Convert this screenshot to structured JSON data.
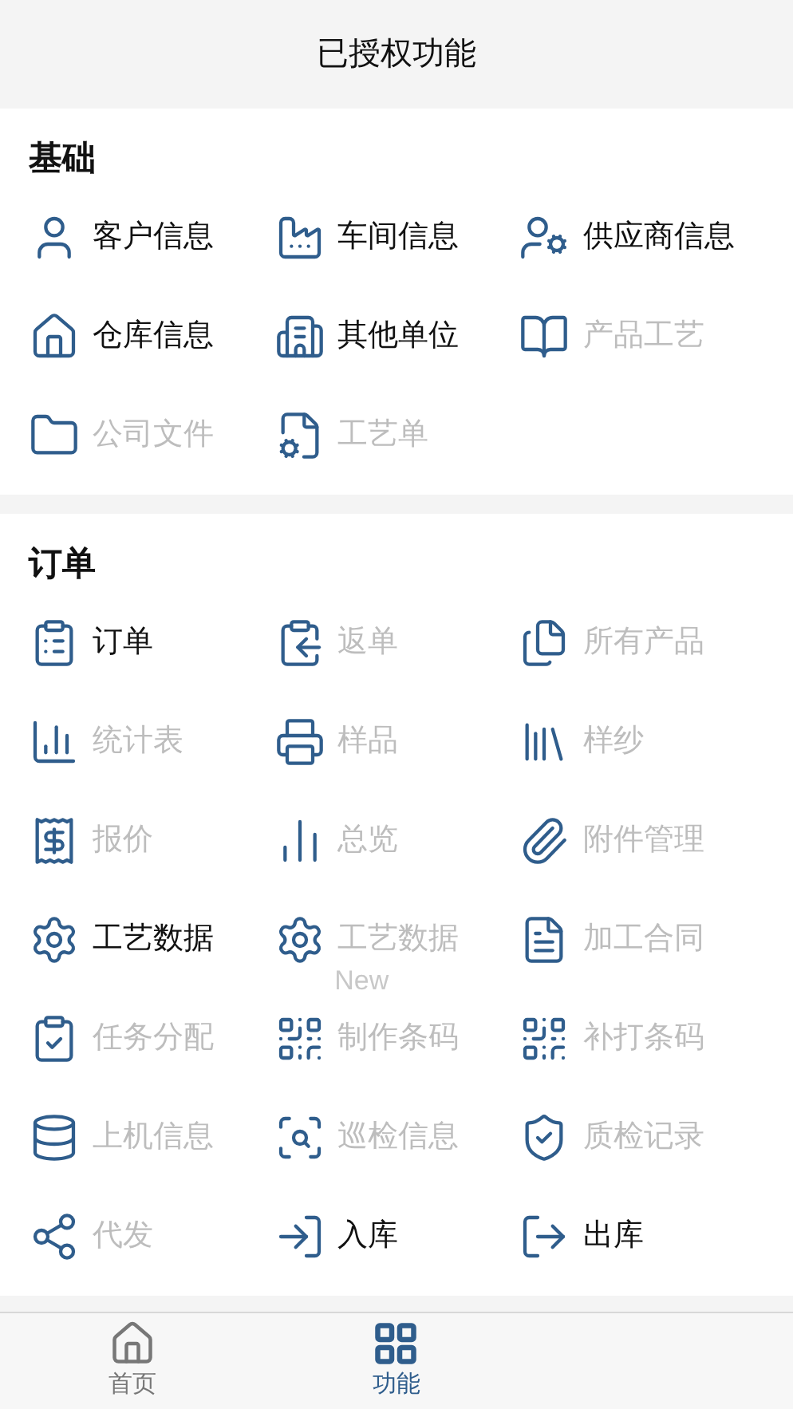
{
  "header": {
    "title": "已授权功能"
  },
  "sections": [
    {
      "title": "基础",
      "items": [
        {
          "label": "客户信息",
          "disabled": false
        },
        {
          "label": "车间信息",
          "disabled": false
        },
        {
          "label": "供应商信息",
          "disabled": false
        },
        {
          "label": "仓库信息",
          "disabled": false
        },
        {
          "label": "其他单位",
          "disabled": false
        },
        {
          "label": "产品工艺",
          "disabled": true
        },
        {
          "label": "公司文件",
          "disabled": true
        },
        {
          "label": "工艺单",
          "disabled": true
        }
      ]
    },
    {
      "title": "订单",
      "items": [
        {
          "label": "订单",
          "disabled": false
        },
        {
          "label": "返单",
          "disabled": true
        },
        {
          "label": "所有产品",
          "disabled": true
        },
        {
          "label": "统计表",
          "disabled": true
        },
        {
          "label": "样品",
          "disabled": true
        },
        {
          "label": "样纱",
          "disabled": true
        },
        {
          "label": "报价",
          "disabled": true
        },
        {
          "label": "总览",
          "disabled": true
        },
        {
          "label": "附件管理",
          "disabled": true
        },
        {
          "label": "工艺数据",
          "disabled": false
        },
        {
          "label": "工艺数据",
          "disabled": true,
          "badge": "New"
        },
        {
          "label": "加工合同",
          "disabled": true
        },
        {
          "label": "任务分配",
          "disabled": true
        },
        {
          "label": "制作条码",
          "disabled": true
        },
        {
          "label": "补打条码",
          "disabled": true
        },
        {
          "label": "上机信息",
          "disabled": true
        },
        {
          "label": "巡检信息",
          "disabled": true
        },
        {
          "label": "质检记录",
          "disabled": true
        },
        {
          "label": "代发",
          "disabled": true
        },
        {
          "label": "入库",
          "disabled": false
        },
        {
          "label": "出库",
          "disabled": false
        }
      ]
    }
  ],
  "tab_bar": [
    {
      "label": "首页",
      "selected": false
    },
    {
      "label": "功能",
      "selected": true
    }
  ]
}
